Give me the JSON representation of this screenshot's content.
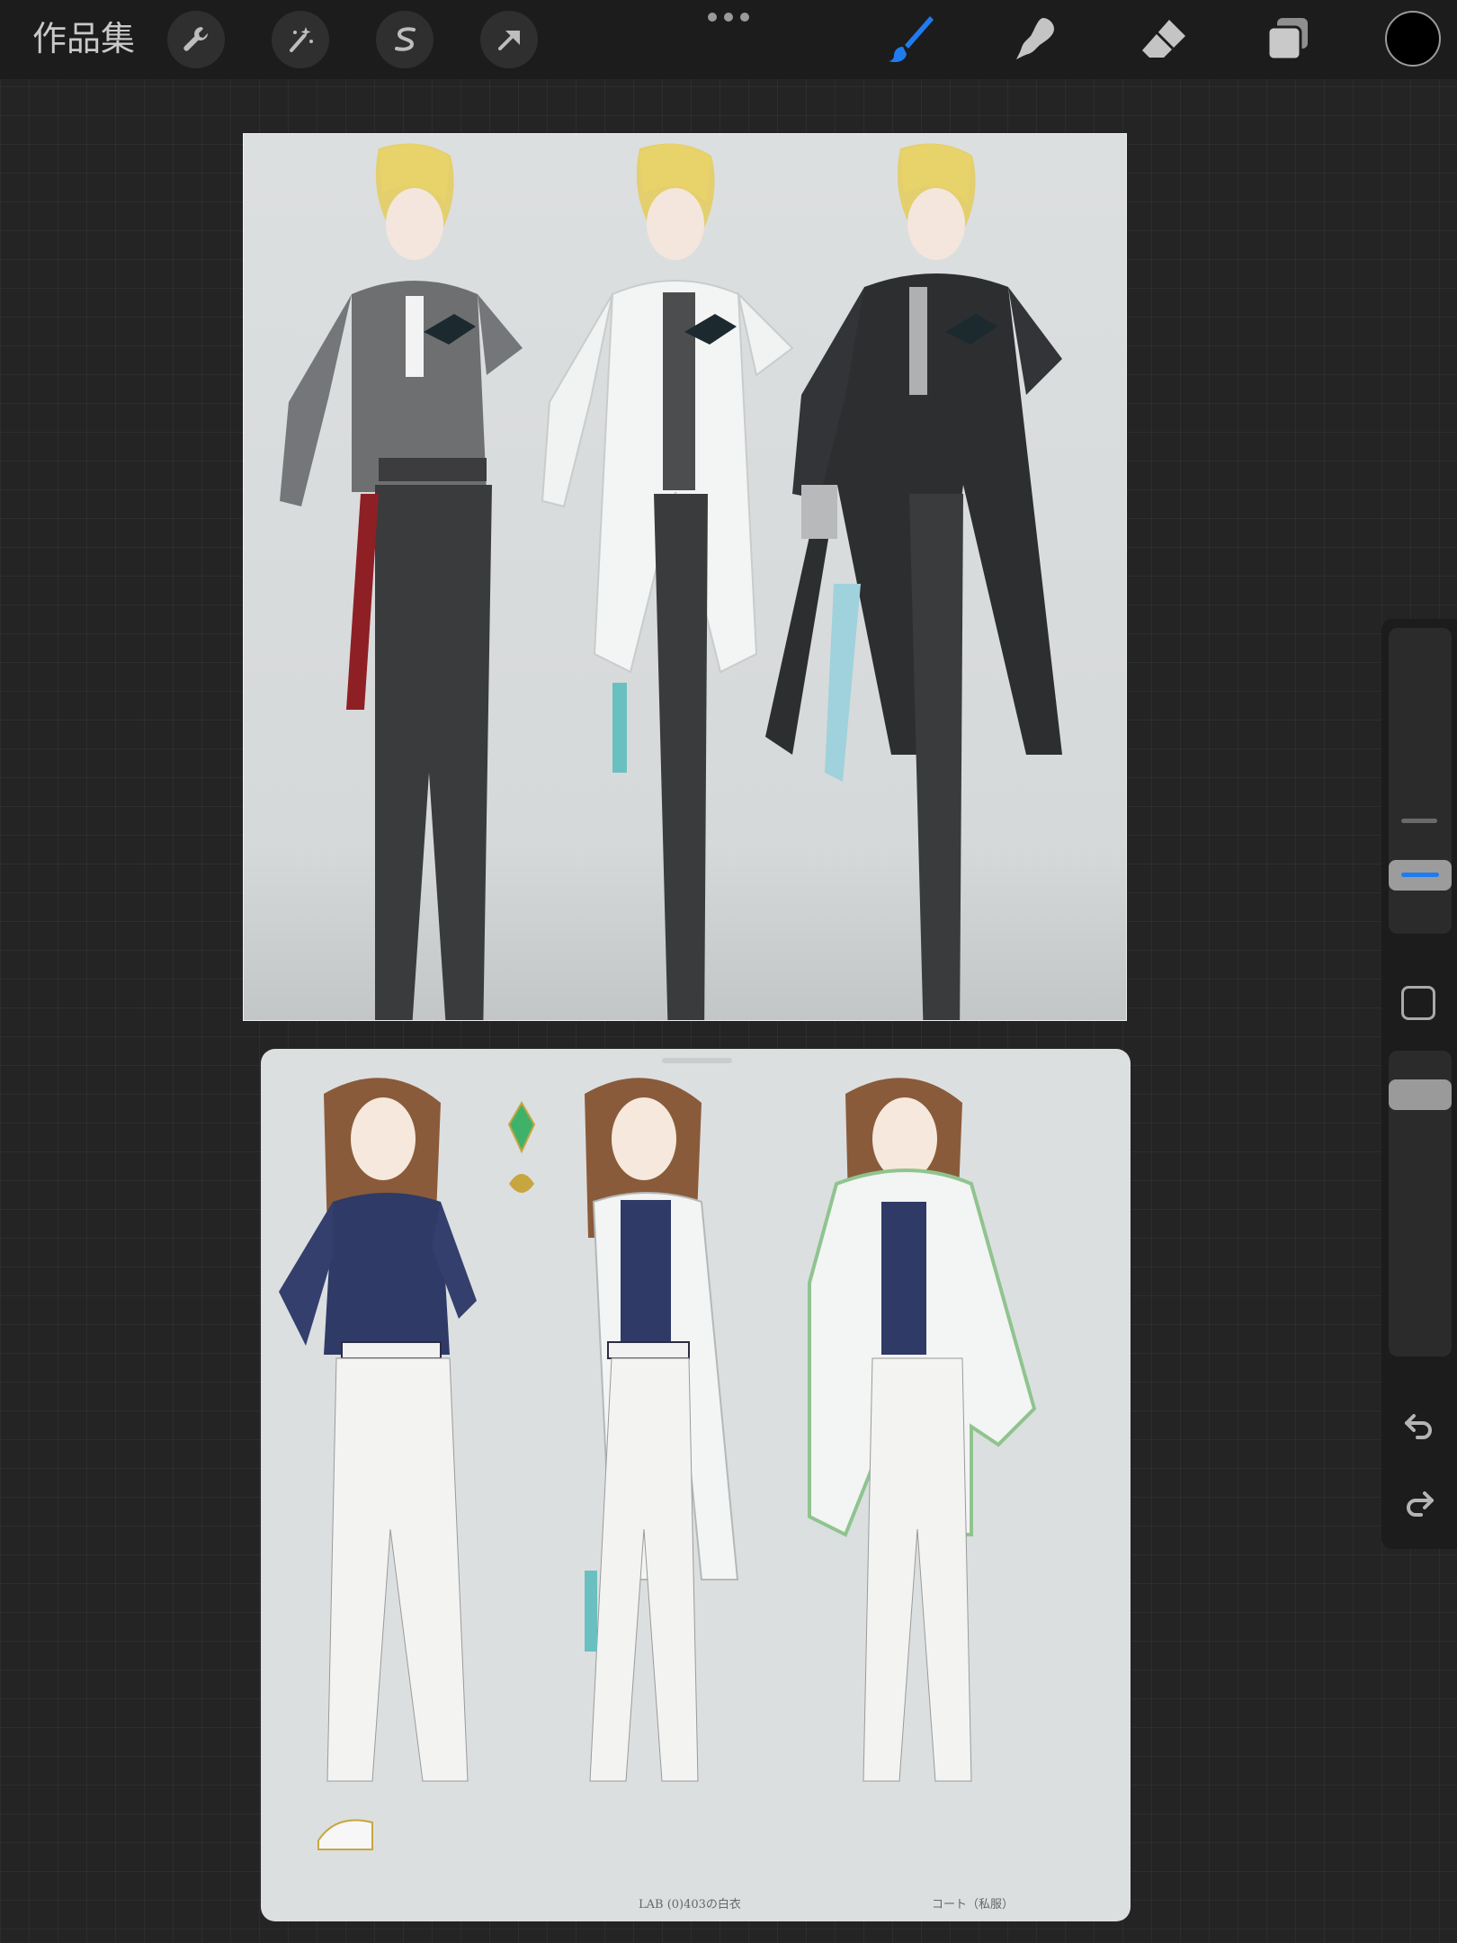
{
  "toolbar": {
    "gallery_label": "作品集",
    "left_tools": [
      "wrench-icon",
      "magic-wand-icon",
      "selection-icon",
      "transform-arrow-icon"
    ],
    "right_tools": [
      "brush-icon",
      "smudge-icon",
      "eraser-icon",
      "layers-icon"
    ],
    "active_tool": "brush",
    "accent_color": "#1f7cf0",
    "current_color": "#000000"
  },
  "canvas_bottom": {
    "caption_lab": "LAB (0)403の白衣",
    "caption_coat": "コート（私服）"
  },
  "sidebar": {
    "brush_size_active": true,
    "undo_icon": "undo-icon",
    "redo_icon": "redo-icon"
  }
}
